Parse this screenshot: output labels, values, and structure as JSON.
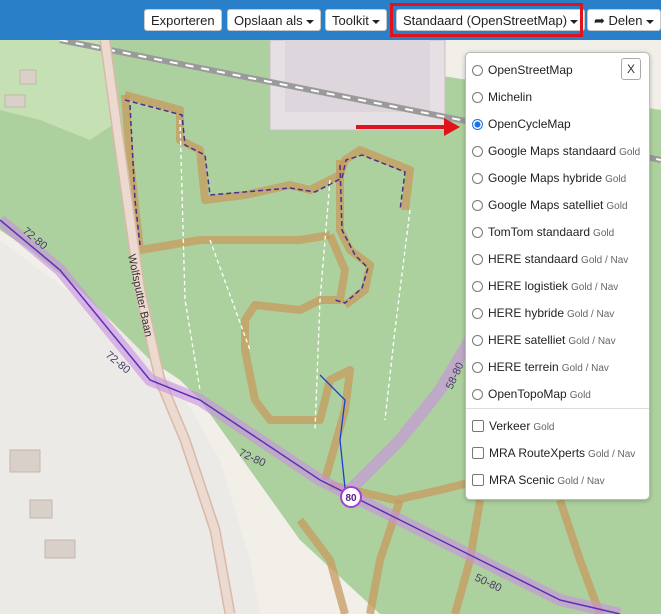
{
  "toolbar": {
    "export_label": "Exporteren",
    "save_as_label": "Opslaan als",
    "toolkit_label": "Toolkit",
    "layer_label": "Standaard (OpenStreetMap)",
    "share_label": "Delen"
  },
  "layers_panel": {
    "close_label": "X",
    "base_layers": [
      {
        "label": "OpenStreetMap",
        "tag": "",
        "selected": false
      },
      {
        "label": "Michelin",
        "tag": "",
        "selected": false
      },
      {
        "label": "OpenCycleMap",
        "tag": "",
        "selected": true
      },
      {
        "label": "Google Maps standaard",
        "tag": "Gold",
        "selected": false
      },
      {
        "label": "Google Maps hybride",
        "tag": "Gold",
        "selected": false
      },
      {
        "label": "Google Maps satelliet",
        "tag": "Gold",
        "selected": false
      },
      {
        "label": "TomTom standaard",
        "tag": "Gold",
        "selected": false
      },
      {
        "label": "HERE standaard",
        "tag": "Gold / Nav",
        "selected": false
      },
      {
        "label": "HERE logistiek",
        "tag": "Gold / Nav",
        "selected": false
      },
      {
        "label": "HERE hybride",
        "tag": "Gold / Nav",
        "selected": false
      },
      {
        "label": "HERE satelliet",
        "tag": "Gold / Nav",
        "selected": false
      },
      {
        "label": "HERE terrein",
        "tag": "Gold / Nav",
        "selected": false
      },
      {
        "label": "OpenTopoMap",
        "tag": "Gold",
        "selected": false
      }
    ],
    "overlays": [
      {
        "label": "Verkeer",
        "tag": "Gold",
        "checked": false
      },
      {
        "label": "MRA RouteXperts",
        "tag": "Gold / Nav",
        "checked": false
      },
      {
        "label": "MRA Scenic",
        "tag": "Gold / Nav",
        "checked": false
      }
    ]
  },
  "map": {
    "road_label": "Wolfsputter Baan",
    "route_labels": [
      "72-80",
      "72-80",
      "72-80",
      "58-80",
      "50-80"
    ],
    "node_number": "80",
    "colors": {
      "forest": "#add19e",
      "cycle_route": "#c79a5f",
      "node_route": "#c98fe3",
      "toolbar": "#2a7fc9",
      "highlight": "#e0131b"
    }
  }
}
